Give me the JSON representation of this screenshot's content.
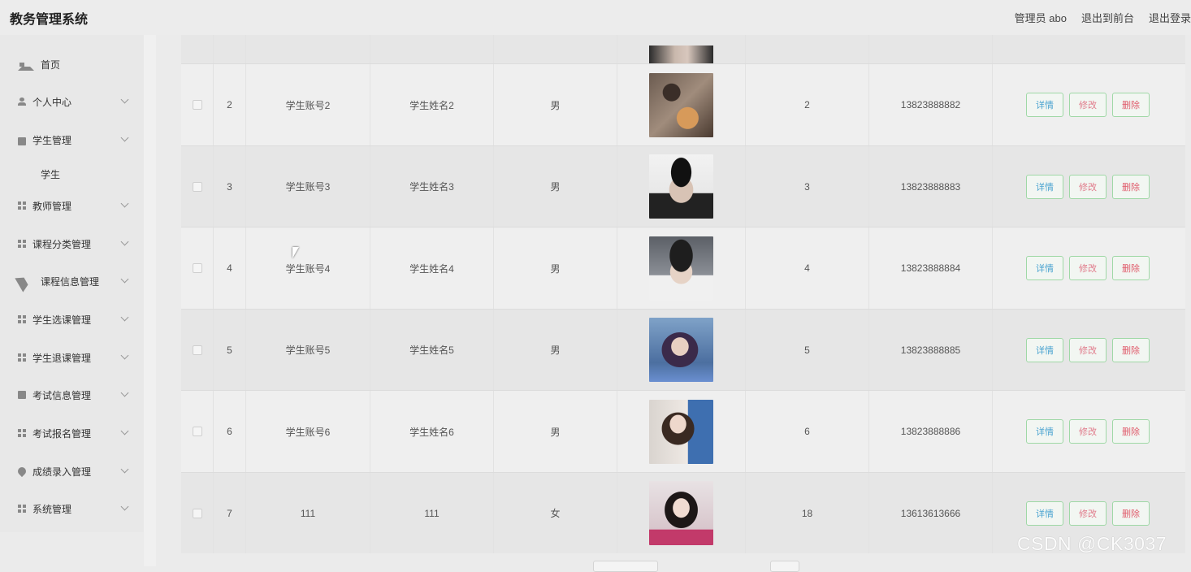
{
  "header": {
    "title": "教务管理系统",
    "admin": "管理员 abo",
    "front": "退出到前台",
    "logout": "退出登录"
  },
  "sidebar": {
    "items": [
      {
        "label": "首页",
        "icon": "home-icon"
      },
      {
        "label": "个人中心",
        "icon": "user-icon"
      },
      {
        "label": "学生管理",
        "icon": "briefcase-icon"
      },
      {
        "label": "教师管理",
        "icon": "grid-icon"
      },
      {
        "label": "课程分类管理",
        "icon": "grid-icon"
      },
      {
        "label": "课程信息管理",
        "icon": "send-icon"
      },
      {
        "label": "学生选课管理",
        "icon": "grid-icon"
      },
      {
        "label": "学生退课管理",
        "icon": "grid-icon"
      },
      {
        "label": "考试信息管理",
        "icon": "monitor-icon"
      },
      {
        "label": "考试报名管理",
        "icon": "grid-icon"
      },
      {
        "label": "成绩录入管理",
        "icon": "pin-icon"
      },
      {
        "label": "系统管理",
        "icon": "grid-icon"
      }
    ],
    "sub_student": "学生"
  },
  "table": {
    "rows": [
      {
        "idx": "2",
        "account": "学生账号2",
        "name": "学生姓名2",
        "gender": "男",
        "num": "2",
        "phone": "13823888882"
      },
      {
        "idx": "3",
        "account": "学生账号3",
        "name": "学生姓名3",
        "gender": "男",
        "num": "3",
        "phone": "13823888883"
      },
      {
        "idx": "4",
        "account": "学生账号4",
        "name": "学生姓名4",
        "gender": "男",
        "num": "4",
        "phone": "13823888884"
      },
      {
        "idx": "5",
        "account": "学生账号5",
        "name": "学生姓名5",
        "gender": "男",
        "num": "5",
        "phone": "13823888885"
      },
      {
        "idx": "6",
        "account": "学生账号6",
        "name": "学生姓名6",
        "gender": "男",
        "num": "6",
        "phone": "13823888886"
      },
      {
        "idx": "7",
        "account": "111",
        "name": "111",
        "gender": "女",
        "num": "18",
        "phone": "13613613666"
      }
    ],
    "actions": {
      "detail": "详情",
      "edit": "修改",
      "delete": "删除"
    }
  },
  "watermark": "CSDN @CK3037"
}
